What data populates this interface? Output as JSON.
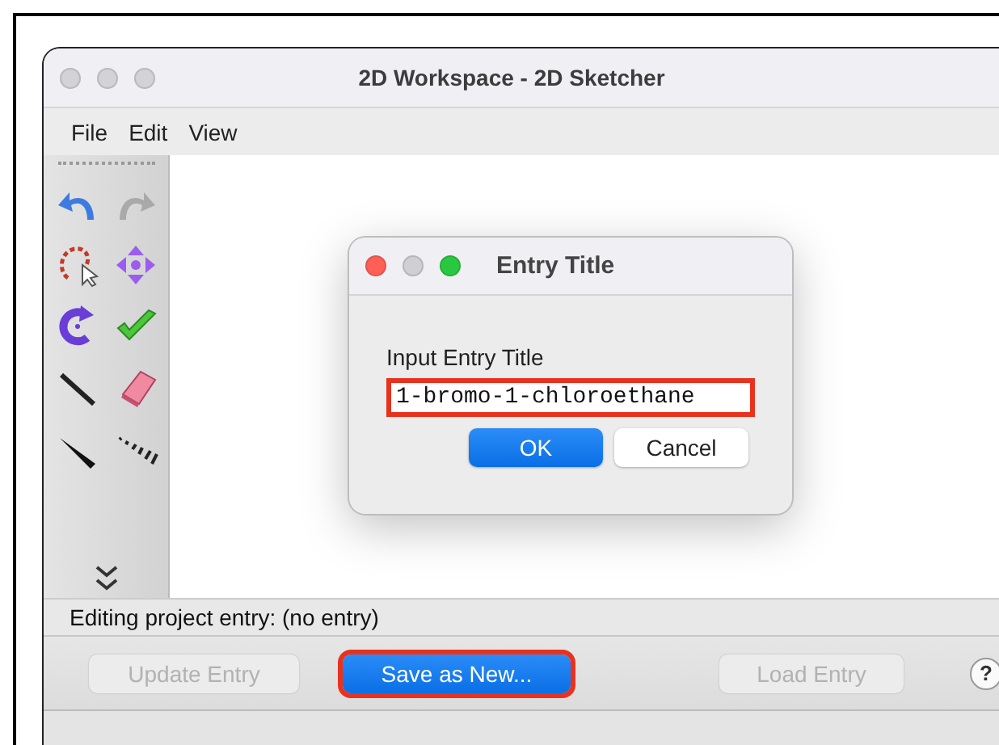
{
  "window": {
    "title": "2D Workspace - 2D Sketcher",
    "active": false
  },
  "menu": [
    "File",
    "Edit",
    "View"
  ],
  "status": "Editing project entry: (no entry)",
  "buttons": [
    {
      "label": "Update Entry",
      "disabled": true,
      "primary": false,
      "highlighted": false
    },
    {
      "label": "Save as New...",
      "disabled": false,
      "primary": true,
      "highlighted": true
    },
    {
      "label": "Load Entry",
      "disabled": true,
      "primary": false,
      "highlighted": false
    }
  ],
  "help_button": {
    "label": "?"
  },
  "dialog": {
    "title": "Entry Title",
    "active": true,
    "prompt": "Input Entry Title",
    "field": {
      "value": "1-bromo-1-chloroethane",
      "highlighted": true
    },
    "buttons": [
      {
        "label": "OK",
        "primary": true
      },
      {
        "label": "Cancel",
        "primary": false
      }
    ]
  }
}
